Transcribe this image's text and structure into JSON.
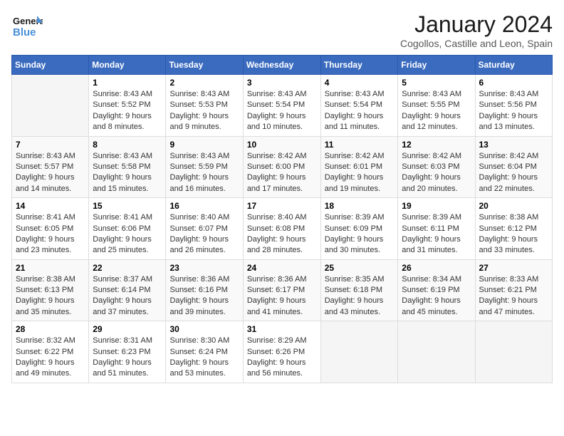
{
  "logo": {
    "text_general": "General",
    "text_blue": "Blue"
  },
  "title": "January 2024",
  "location": "Cogollos, Castille and Leon, Spain",
  "weekdays": [
    "Sunday",
    "Monday",
    "Tuesday",
    "Wednesday",
    "Thursday",
    "Friday",
    "Saturday"
  ],
  "weeks": [
    [
      {
        "day": "",
        "info": ""
      },
      {
        "day": "1",
        "info": "Sunrise: 8:43 AM\nSunset: 5:52 PM\nDaylight: 9 hours\nand 8 minutes."
      },
      {
        "day": "2",
        "info": "Sunrise: 8:43 AM\nSunset: 5:53 PM\nDaylight: 9 hours\nand 9 minutes."
      },
      {
        "day": "3",
        "info": "Sunrise: 8:43 AM\nSunset: 5:54 PM\nDaylight: 9 hours\nand 10 minutes."
      },
      {
        "day": "4",
        "info": "Sunrise: 8:43 AM\nSunset: 5:54 PM\nDaylight: 9 hours\nand 11 minutes."
      },
      {
        "day": "5",
        "info": "Sunrise: 8:43 AM\nSunset: 5:55 PM\nDaylight: 9 hours\nand 12 minutes."
      },
      {
        "day": "6",
        "info": "Sunrise: 8:43 AM\nSunset: 5:56 PM\nDaylight: 9 hours\nand 13 minutes."
      }
    ],
    [
      {
        "day": "7",
        "info": "Sunrise: 8:43 AM\nSunset: 5:57 PM\nDaylight: 9 hours\nand 14 minutes."
      },
      {
        "day": "8",
        "info": "Sunrise: 8:43 AM\nSunset: 5:58 PM\nDaylight: 9 hours\nand 15 minutes."
      },
      {
        "day": "9",
        "info": "Sunrise: 8:43 AM\nSunset: 5:59 PM\nDaylight: 9 hours\nand 16 minutes."
      },
      {
        "day": "10",
        "info": "Sunrise: 8:42 AM\nSunset: 6:00 PM\nDaylight: 9 hours\nand 17 minutes."
      },
      {
        "day": "11",
        "info": "Sunrise: 8:42 AM\nSunset: 6:01 PM\nDaylight: 9 hours\nand 19 minutes."
      },
      {
        "day": "12",
        "info": "Sunrise: 8:42 AM\nSunset: 6:03 PM\nDaylight: 9 hours\nand 20 minutes."
      },
      {
        "day": "13",
        "info": "Sunrise: 8:42 AM\nSunset: 6:04 PM\nDaylight: 9 hours\nand 22 minutes."
      }
    ],
    [
      {
        "day": "14",
        "info": "Sunrise: 8:41 AM\nSunset: 6:05 PM\nDaylight: 9 hours\nand 23 minutes."
      },
      {
        "day": "15",
        "info": "Sunrise: 8:41 AM\nSunset: 6:06 PM\nDaylight: 9 hours\nand 25 minutes."
      },
      {
        "day": "16",
        "info": "Sunrise: 8:40 AM\nSunset: 6:07 PM\nDaylight: 9 hours\nand 26 minutes."
      },
      {
        "day": "17",
        "info": "Sunrise: 8:40 AM\nSunset: 6:08 PM\nDaylight: 9 hours\nand 28 minutes."
      },
      {
        "day": "18",
        "info": "Sunrise: 8:39 AM\nSunset: 6:09 PM\nDaylight: 9 hours\nand 30 minutes."
      },
      {
        "day": "19",
        "info": "Sunrise: 8:39 AM\nSunset: 6:11 PM\nDaylight: 9 hours\nand 31 minutes."
      },
      {
        "day": "20",
        "info": "Sunrise: 8:38 AM\nSunset: 6:12 PM\nDaylight: 9 hours\nand 33 minutes."
      }
    ],
    [
      {
        "day": "21",
        "info": "Sunrise: 8:38 AM\nSunset: 6:13 PM\nDaylight: 9 hours\nand 35 minutes."
      },
      {
        "day": "22",
        "info": "Sunrise: 8:37 AM\nSunset: 6:14 PM\nDaylight: 9 hours\nand 37 minutes."
      },
      {
        "day": "23",
        "info": "Sunrise: 8:36 AM\nSunset: 6:16 PM\nDaylight: 9 hours\nand 39 minutes."
      },
      {
        "day": "24",
        "info": "Sunrise: 8:36 AM\nSunset: 6:17 PM\nDaylight: 9 hours\nand 41 minutes."
      },
      {
        "day": "25",
        "info": "Sunrise: 8:35 AM\nSunset: 6:18 PM\nDaylight: 9 hours\nand 43 minutes."
      },
      {
        "day": "26",
        "info": "Sunrise: 8:34 AM\nSunset: 6:19 PM\nDaylight: 9 hours\nand 45 minutes."
      },
      {
        "day": "27",
        "info": "Sunrise: 8:33 AM\nSunset: 6:21 PM\nDaylight: 9 hours\nand 47 minutes."
      }
    ],
    [
      {
        "day": "28",
        "info": "Sunrise: 8:32 AM\nSunset: 6:22 PM\nDaylight: 9 hours\nand 49 minutes."
      },
      {
        "day": "29",
        "info": "Sunrise: 8:31 AM\nSunset: 6:23 PM\nDaylight: 9 hours\nand 51 minutes."
      },
      {
        "day": "30",
        "info": "Sunrise: 8:30 AM\nSunset: 6:24 PM\nDaylight: 9 hours\nand 53 minutes."
      },
      {
        "day": "31",
        "info": "Sunrise: 8:29 AM\nSunset: 6:26 PM\nDaylight: 9 hours\nand 56 minutes."
      },
      {
        "day": "",
        "info": ""
      },
      {
        "day": "",
        "info": ""
      },
      {
        "day": "",
        "info": ""
      }
    ]
  ]
}
